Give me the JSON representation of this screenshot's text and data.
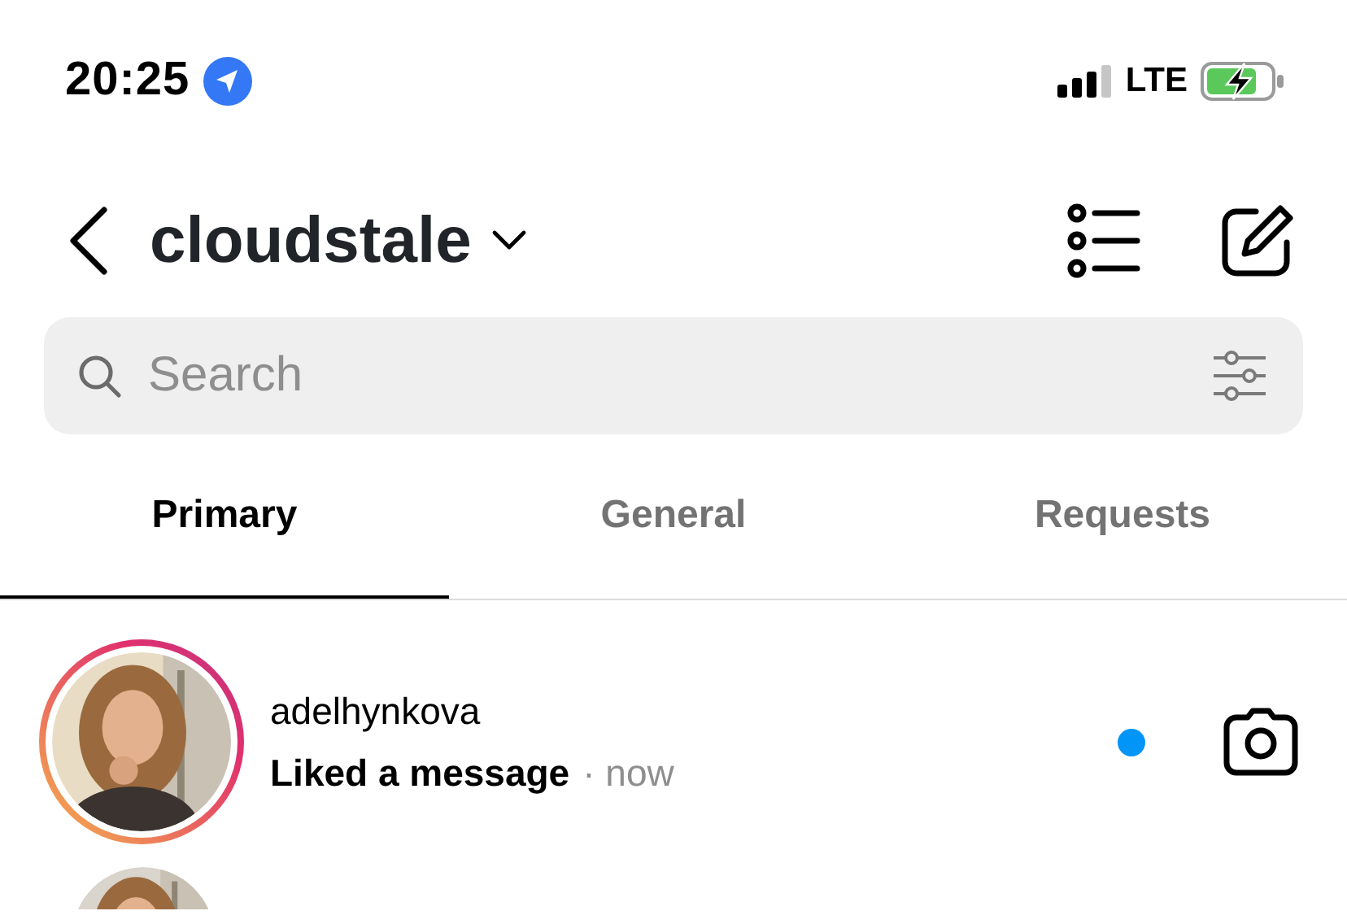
{
  "status_bar": {
    "time": "20:25",
    "location_active": true,
    "network": "LTE",
    "charging": true
  },
  "header": {
    "account": "cloudstale"
  },
  "search": {
    "placeholder": "Search"
  },
  "tabs": [
    {
      "label": "Primary",
      "selected": true
    },
    {
      "label": "General",
      "selected": false
    },
    {
      "label": "Requests",
      "selected": false
    }
  ],
  "conversations": [
    {
      "username": "adelhynkova",
      "message": "Liked a message",
      "time": "· now",
      "unread": true,
      "story_ring": true
    },
    {
      "story_ring": false
    }
  ]
}
